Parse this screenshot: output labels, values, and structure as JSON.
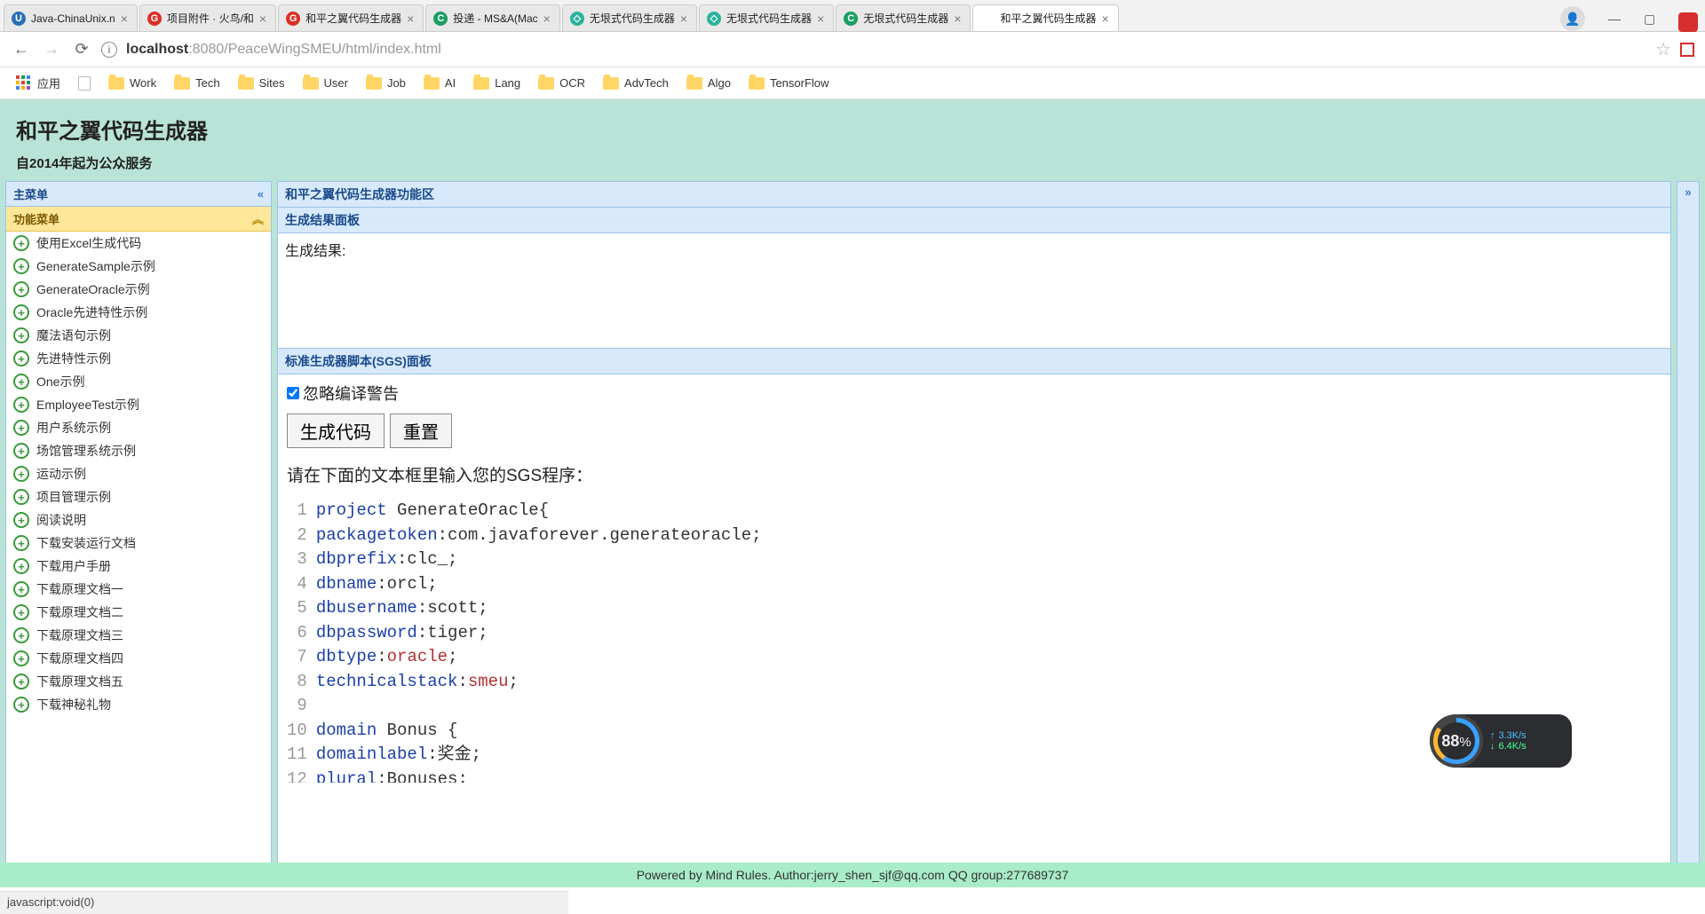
{
  "browser": {
    "tabs": [
      {
        "label": "Java-ChinaUnix.n",
        "fav": "U",
        "favbg": "#2a6fb5"
      },
      {
        "label": "项目附件 · 火鸟/和",
        "fav": "G",
        "favbg": "#d93025"
      },
      {
        "label": "和平之翼代码生成器",
        "fav": "G",
        "favbg": "#d93025"
      },
      {
        "label": "投递 - MS&A(Mac",
        "fav": "C",
        "favbg": "#1a9e62"
      },
      {
        "label": "无垠式代码生成器",
        "fav": "◇",
        "favbg": "#2bb39a"
      },
      {
        "label": "无垠式代码生成器",
        "fav": "◇",
        "favbg": "#2bb39a"
      },
      {
        "label": "无垠式代码生成器",
        "fav": "C",
        "favbg": "#1a9e62"
      },
      {
        "label": "和平之翼代码生成器",
        "fav": "",
        "favbg": "#fff",
        "active": true
      }
    ],
    "url_host": "localhost",
    "url_port": ":8080",
    "url_path": "/PeaceWingSMEU/html/index.html",
    "apps_label": "应用",
    "bookmarks": [
      "Work",
      "Tech",
      "Sites",
      "User",
      "Job",
      "AI",
      "Lang",
      "OCR",
      "AdvTech",
      "Algo",
      "TensorFlow"
    ]
  },
  "app": {
    "title": "和平之翼代码生成器",
    "subtitle": "自2014年起为公众服务",
    "sidebar_title": "主菜单",
    "func_title": "功能菜单",
    "menu": [
      "使用Excel生成代码",
      "GenerateSample示例",
      "GenerateOracle示例",
      "Oracle先进特性示例",
      "魔法语句示例",
      "先进特性示例",
      "One示例",
      "EmployeeTest示例",
      "用户系统示例",
      "场馆管理系统示例",
      "运动示例",
      "项目管理示例",
      "阅读说明",
      "下载安装运行文档",
      "下载用户手册",
      "下载原理文档一",
      "下载原理文档二",
      "下载原理文档三",
      "下载原理文档四",
      "下载原理文档五",
      "下载神秘礼物"
    ],
    "main_title": "和平之翼代码生成器功能区",
    "result_panel_title": "生成结果面板",
    "result_label": "生成结果:",
    "sgs_panel_title": "标准生成器脚本(SGS)面板",
    "ignore_warnings": "忽略编译警告",
    "btn_generate": "生成代码",
    "btn_reset": "重置",
    "sgs_prompt": "请在下面的文本框里输入您的SGS程序：",
    "code": [
      [
        [
          "kw",
          "project"
        ],
        [
          "punct",
          " GenerateOracle{"
        ]
      ],
      [
        [
          "prop",
          "packagetoken"
        ],
        [
          "punct",
          ":com.javaforever.generateoracle;"
        ]
      ],
      [
        [
          "prop",
          "dbprefix"
        ],
        [
          "punct",
          ":clc_;"
        ]
      ],
      [
        [
          "prop",
          "dbname"
        ],
        [
          "punct",
          ":orcl;"
        ]
      ],
      [
        [
          "prop",
          "dbusername"
        ],
        [
          "punct",
          ":scott;"
        ]
      ],
      [
        [
          "prop",
          "dbpassword"
        ],
        [
          "punct",
          ":tiger;"
        ]
      ],
      [
        [
          "prop",
          "dbtype"
        ],
        [
          "punct",
          ":"
        ],
        [
          "val",
          "oracle"
        ],
        [
          "punct",
          ";"
        ]
      ],
      [
        [
          "prop",
          "technicalstack"
        ],
        [
          "punct",
          ":"
        ],
        [
          "val",
          "smeu"
        ],
        [
          "punct",
          ";"
        ]
      ],
      [],
      [
        [
          "kw",
          "domain"
        ],
        [
          "punct",
          " Bonus {"
        ]
      ],
      [
        [
          "prop",
          "domainlabel"
        ],
        [
          "punct",
          ":奖金;"
        ]
      ],
      [
        [
          "prop",
          "plural"
        ],
        [
          "punct",
          ":Bonuses;"
        ]
      ]
    ],
    "footer": "Powered by Mind Rules. Author:jerry_shen_sjf@qq.com QQ group:277689737",
    "status": "javascript:void(0)"
  },
  "netwidget": {
    "pct": "88",
    "pct_unit": "%",
    "up": "3.3K/s",
    "down": "6.4K/s"
  }
}
